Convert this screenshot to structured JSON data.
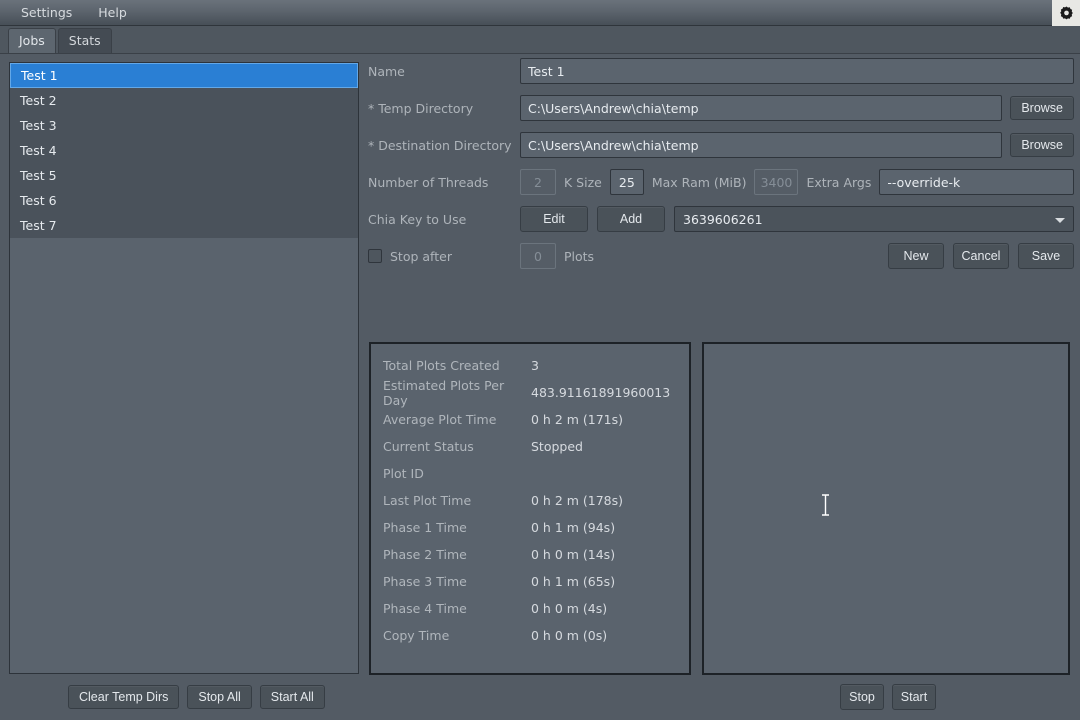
{
  "menubar": {
    "items": [
      {
        "label": "Settings"
      },
      {
        "label": "Help"
      }
    ],
    "gear_icon": "gear-icon"
  },
  "tabs": [
    {
      "label": "Jobs",
      "active": true
    },
    {
      "label": "Stats",
      "active": false
    }
  ],
  "joblist": {
    "items": [
      {
        "label": "Test 1",
        "selected": true
      },
      {
        "label": "Test 2",
        "selected": false
      },
      {
        "label": "Test 3",
        "selected": false
      },
      {
        "label": "Test 4",
        "selected": false
      },
      {
        "label": "Test 5",
        "selected": false
      },
      {
        "label": "Test 6",
        "selected": false
      },
      {
        "label": "Test 7",
        "selected": false
      }
    ]
  },
  "bottom_left_buttons": [
    {
      "label": "Clear Temp Dirs"
    },
    {
      "label": "Stop All"
    },
    {
      "label": "Start All"
    }
  ],
  "bottom_right_buttons": [
    {
      "label": "Stop"
    },
    {
      "label": "Start"
    }
  ],
  "form": {
    "name": {
      "label": "Name",
      "value": "Test 1"
    },
    "temp_dir": {
      "label": "* Temp Directory",
      "value": "C:\\Users\\Andrew\\chia\\temp",
      "browse_label": "Browse"
    },
    "dest_dir": {
      "label": "* Destination Directory",
      "value": "C:\\Users\\Andrew\\chia\\temp",
      "browse_label": "Browse"
    },
    "threads": {
      "label": "Number of Threads",
      "value": "2",
      "disabled": true
    },
    "ksize": {
      "label": "K Size",
      "value": "25"
    },
    "max_ram": {
      "label": "Max Ram (MiB)",
      "value": "3400",
      "disabled": true
    },
    "extra_args": {
      "label": "Extra Args",
      "value": "--override-k"
    },
    "chia_key": {
      "label": "Chia Key to Use",
      "edit_label": "Edit",
      "add_label": "Add",
      "selected": "3639606261"
    },
    "stop_after": {
      "label": "Stop after",
      "checked": false,
      "value": "0",
      "unit_label": "Plots"
    },
    "actions": {
      "new_label": "New",
      "cancel_label": "Cancel",
      "save_label": "Save"
    }
  },
  "stats": {
    "rows": [
      {
        "key": "Total Plots Created",
        "value": "3"
      },
      {
        "key": "Estimated Plots Per Day",
        "value": "483.91161891960013"
      },
      {
        "key": "Average Plot Time",
        "value": "0 h 2 m (171s)"
      },
      {
        "key": "Current Status",
        "value": "Stopped"
      },
      {
        "key": "Plot ID",
        "value": ""
      },
      {
        "key": "Last Plot Time",
        "value": "0 h 2 m (178s)"
      },
      {
        "key": "Phase 1 Time",
        "value": "0 h 1 m (94s)"
      },
      {
        "key": "Phase 2 Time",
        "value": "0 h 0 m (14s)"
      },
      {
        "key": "Phase 3 Time",
        "value": "0 h 1 m (65s)"
      },
      {
        "key": "Phase 4 Time",
        "value": "0 h 0 m (4s)"
      },
      {
        "key": "Copy Time",
        "value": "0 h 0 m (0s)"
      }
    ]
  },
  "log": {
    "content": ""
  },
  "colors": {
    "background": "#535b64",
    "selection": "#2a7fd4",
    "panel": "#5a636d",
    "input": "#5b646e",
    "text": "#e6eaee",
    "label": "#aeb4ba"
  }
}
